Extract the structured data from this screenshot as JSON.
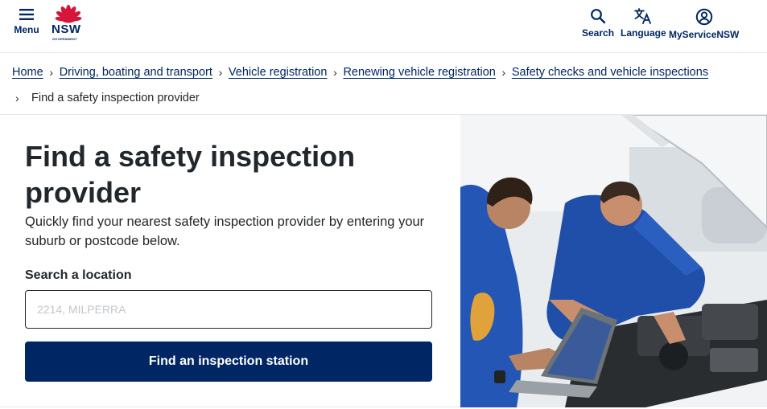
{
  "header": {
    "menu_label": "Menu",
    "logo_text": "NSW",
    "logo_subtext": "GOVERNMENT",
    "search_label": "Search",
    "language_label": "Language",
    "account_label": "MyServiceNSW"
  },
  "breadcrumb": {
    "items": [
      "Home",
      "Driving, boating and transport",
      "Vehicle registration",
      "Renewing vehicle registration",
      "Safety checks and vehicle inspections"
    ],
    "current": "Find a safety inspection provider"
  },
  "main": {
    "title": "Find a safety inspection provider",
    "intro": "Quickly find your nearest safety inspection provider by entering your suburb or postcode below.",
    "search_label": "Search a location",
    "search_placeholder": "2214, MILPERRA",
    "button_label": "Find an inspection station"
  },
  "colors": {
    "brand_navy": "#002664",
    "brand_red": "#d7153a",
    "text": "#22272b"
  },
  "icons": {
    "menu": "hamburger-icon",
    "search": "magnifier-icon",
    "language": "translate-icon",
    "account": "user-circle-icon",
    "breadcrumb_separator": "chevron-right-icon"
  }
}
